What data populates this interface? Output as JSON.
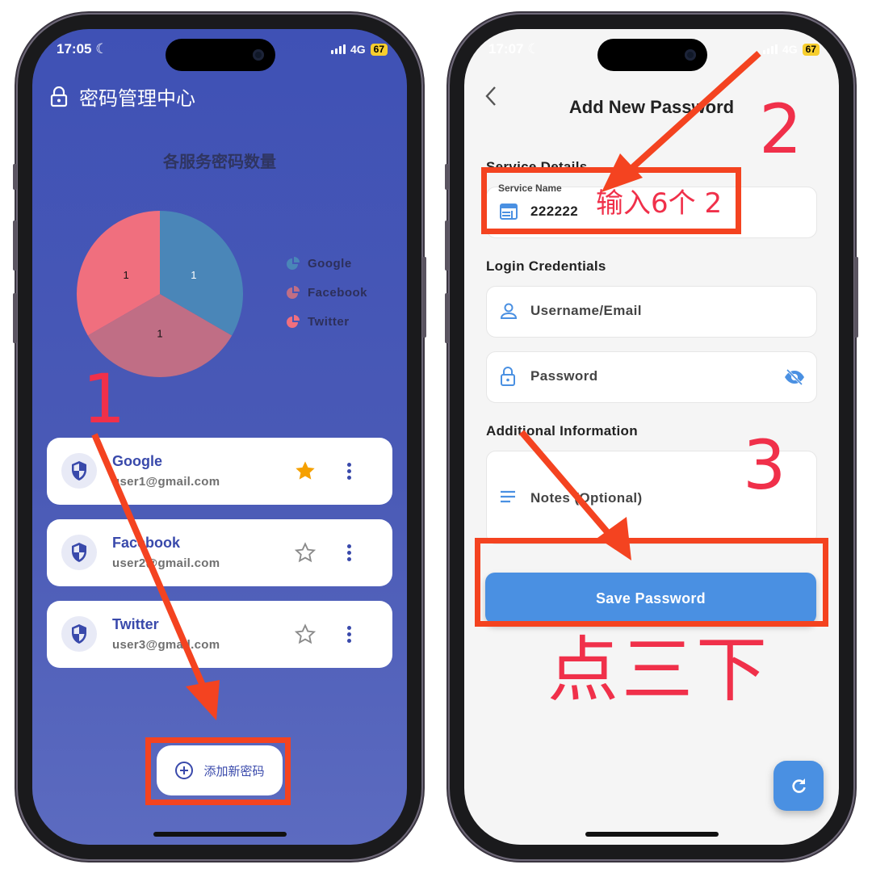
{
  "left_phone": {
    "status": {
      "time": "17:05",
      "network": "4G",
      "battery": "67"
    },
    "app_title": "密码管理中心",
    "chart_data": {
      "type": "pie",
      "title": "各服务密码数量",
      "categories": [
        "Google",
        "Facebook",
        "Twitter"
      ],
      "values": [
        1,
        1,
        1
      ],
      "colors": [
        "#4a86b8",
        "#c06e85",
        "#f06f7e"
      ],
      "data_labels": [
        "1",
        "1",
        "1"
      ],
      "legend_position": "right"
    },
    "entries": [
      {
        "service": "Google",
        "email": "user1@gmail.com",
        "favorite": true
      },
      {
        "service": "Facebook",
        "email": "user2@gmail.com",
        "favorite": false
      },
      {
        "service": "Twitter",
        "email": "user3@gmail.com",
        "favorite": false
      }
    ],
    "add_button_label": "添加新密码"
  },
  "right_phone": {
    "status": {
      "time": "17:07",
      "network": "4G",
      "battery": "67"
    },
    "page_title": "Add New Password",
    "sections": {
      "service": "Service Details",
      "login": "Login Credentials",
      "additional": "Additional Information"
    },
    "service_name": {
      "label": "Service Name",
      "value": "222222"
    },
    "username_placeholder": "Username/Email",
    "password_placeholder": "Password",
    "notes_placeholder": "Notes (Optional)",
    "save_button_label": "Save Password"
  },
  "annotations": {
    "step1": "1",
    "step2": "2",
    "step3": "3",
    "step2_note": "输入6个 2",
    "step3_note": "点三下"
  },
  "colors": {
    "primary_blue": "#3f51b5",
    "accent_blue": "#4a90e2",
    "star": "#f5a000",
    "annotation_red": "#f44320"
  }
}
